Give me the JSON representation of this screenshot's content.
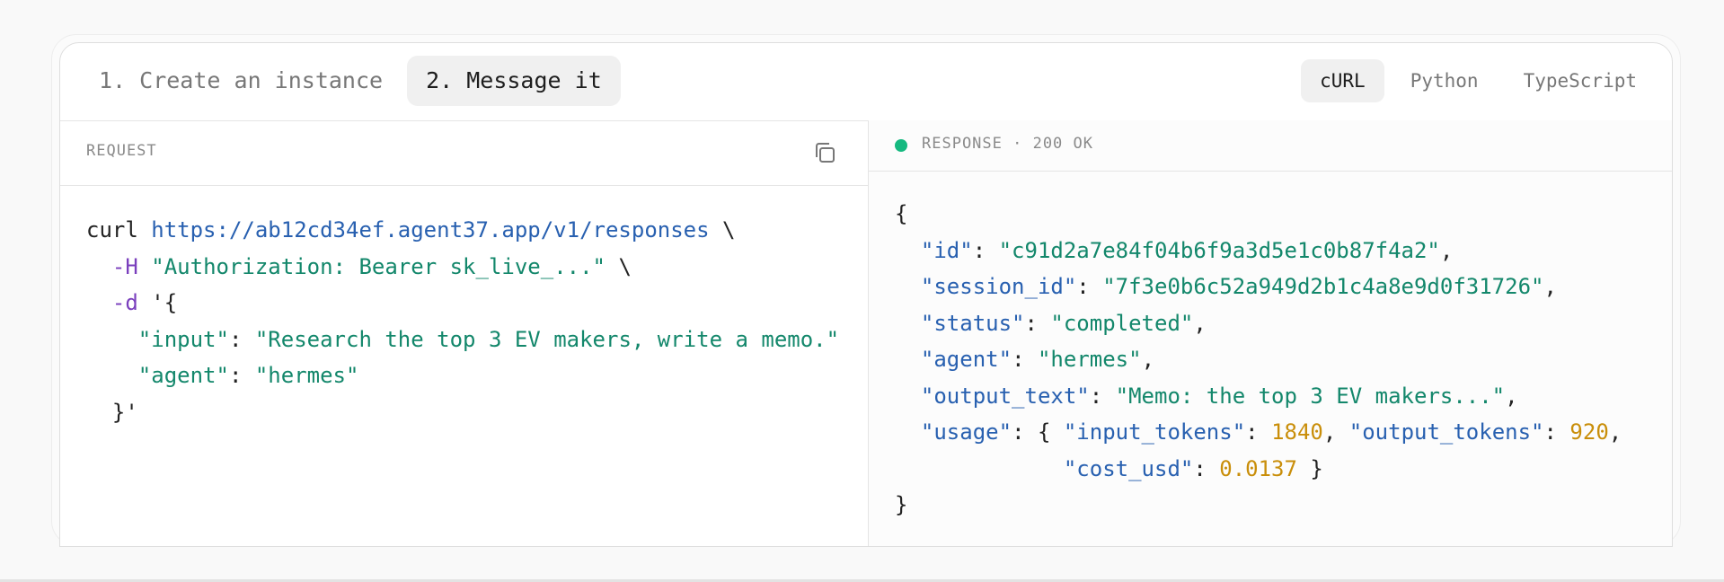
{
  "steps": [
    {
      "label": "1. Create an instance",
      "active": false
    },
    {
      "label": "2. Message it",
      "active": true
    }
  ],
  "languages": [
    {
      "label": "cURL",
      "active": true
    },
    {
      "label": "Python",
      "active": false
    },
    {
      "label": "TypeScript",
      "active": false
    }
  ],
  "request": {
    "header": "REQUEST",
    "copy_icon": "copy-icon",
    "lines": [
      [
        {
          "t": "plain",
          "v": "curl "
        },
        {
          "t": "url",
          "v": "https://ab12cd34ef.agent37.app/v1/responses"
        },
        {
          "t": "plain",
          "v": " \\"
        }
      ],
      [
        {
          "t": "plain",
          "v": "  "
        },
        {
          "t": "flag",
          "v": "-H"
        },
        {
          "t": "plain",
          "v": " "
        },
        {
          "t": "str",
          "v": "\"Authorization: Bearer sk_live_...\""
        },
        {
          "t": "plain",
          "v": " \\"
        }
      ],
      [
        {
          "t": "plain",
          "v": "  "
        },
        {
          "t": "flag",
          "v": "-d"
        },
        {
          "t": "plain",
          "v": " '{"
        }
      ],
      [
        {
          "t": "plain",
          "v": "    "
        },
        {
          "t": "str",
          "v": "\"input\""
        },
        {
          "t": "plain",
          "v": ": "
        },
        {
          "t": "str",
          "v": "\"Research the top 3 EV makers, write a memo.\""
        }
      ],
      [
        {
          "t": "plain",
          "v": "    "
        },
        {
          "t": "str",
          "v": "\"agent\""
        },
        {
          "t": "plain",
          "v": ": "
        },
        {
          "t": "str",
          "v": "\"hermes\""
        }
      ],
      [
        {
          "t": "plain",
          "v": "  }'"
        }
      ]
    ]
  },
  "response": {
    "header": "RESPONSE · 200 OK",
    "status_color": "#16b980",
    "lines": [
      [
        {
          "t": "plain",
          "v": "{"
        }
      ],
      [
        {
          "t": "plain",
          "v": "  "
        },
        {
          "t": "key",
          "v": "\"id\""
        },
        {
          "t": "plain",
          "v": ": "
        },
        {
          "t": "str",
          "v": "\"c91d2a7e84f04b6f9a3d5e1c0b87f4a2\""
        },
        {
          "t": "plain",
          "v": ","
        }
      ],
      [
        {
          "t": "plain",
          "v": "  "
        },
        {
          "t": "key",
          "v": "\"session_id\""
        },
        {
          "t": "plain",
          "v": ": "
        },
        {
          "t": "str",
          "v": "\"7f3e0b6c52a949d2b1c4a8e9d0f31726\""
        },
        {
          "t": "plain",
          "v": ","
        }
      ],
      [
        {
          "t": "plain",
          "v": "  "
        },
        {
          "t": "key",
          "v": "\"status\""
        },
        {
          "t": "plain",
          "v": ": "
        },
        {
          "t": "str",
          "v": "\"completed\""
        },
        {
          "t": "plain",
          "v": ","
        }
      ],
      [
        {
          "t": "plain",
          "v": "  "
        },
        {
          "t": "key",
          "v": "\"agent\""
        },
        {
          "t": "plain",
          "v": ": "
        },
        {
          "t": "str",
          "v": "\"hermes\""
        },
        {
          "t": "plain",
          "v": ","
        }
      ],
      [
        {
          "t": "plain",
          "v": "  "
        },
        {
          "t": "key",
          "v": "\"output_text\""
        },
        {
          "t": "plain",
          "v": ": "
        },
        {
          "t": "str",
          "v": "\"Memo: the top 3 EV makers...\""
        },
        {
          "t": "plain",
          "v": ","
        }
      ],
      [
        {
          "t": "plain",
          "v": "  "
        },
        {
          "t": "key",
          "v": "\"usage\""
        },
        {
          "t": "plain",
          "v": ": { "
        },
        {
          "t": "key",
          "v": "\"input_tokens\""
        },
        {
          "t": "plain",
          "v": ": "
        },
        {
          "t": "num",
          "v": "1840"
        },
        {
          "t": "plain",
          "v": ", "
        },
        {
          "t": "key",
          "v": "\"output_tokens\""
        },
        {
          "t": "plain",
          "v": ": "
        },
        {
          "t": "num",
          "v": "920"
        },
        {
          "t": "plain",
          "v": ","
        }
      ],
      [
        {
          "t": "plain",
          "v": "             "
        },
        {
          "t": "key",
          "v": "\"cost_usd\""
        },
        {
          "t": "plain",
          "v": ": "
        },
        {
          "t": "num",
          "v": "0.0137"
        },
        {
          "t": "plain",
          "v": " }"
        }
      ],
      [
        {
          "t": "plain",
          "v": "}"
        }
      ]
    ]
  },
  "colors": {
    "url": "#2860b0",
    "string": "#13876b",
    "flag": "#7a3fbd",
    "key": "#2860b0",
    "number": "#c98e0a"
  }
}
